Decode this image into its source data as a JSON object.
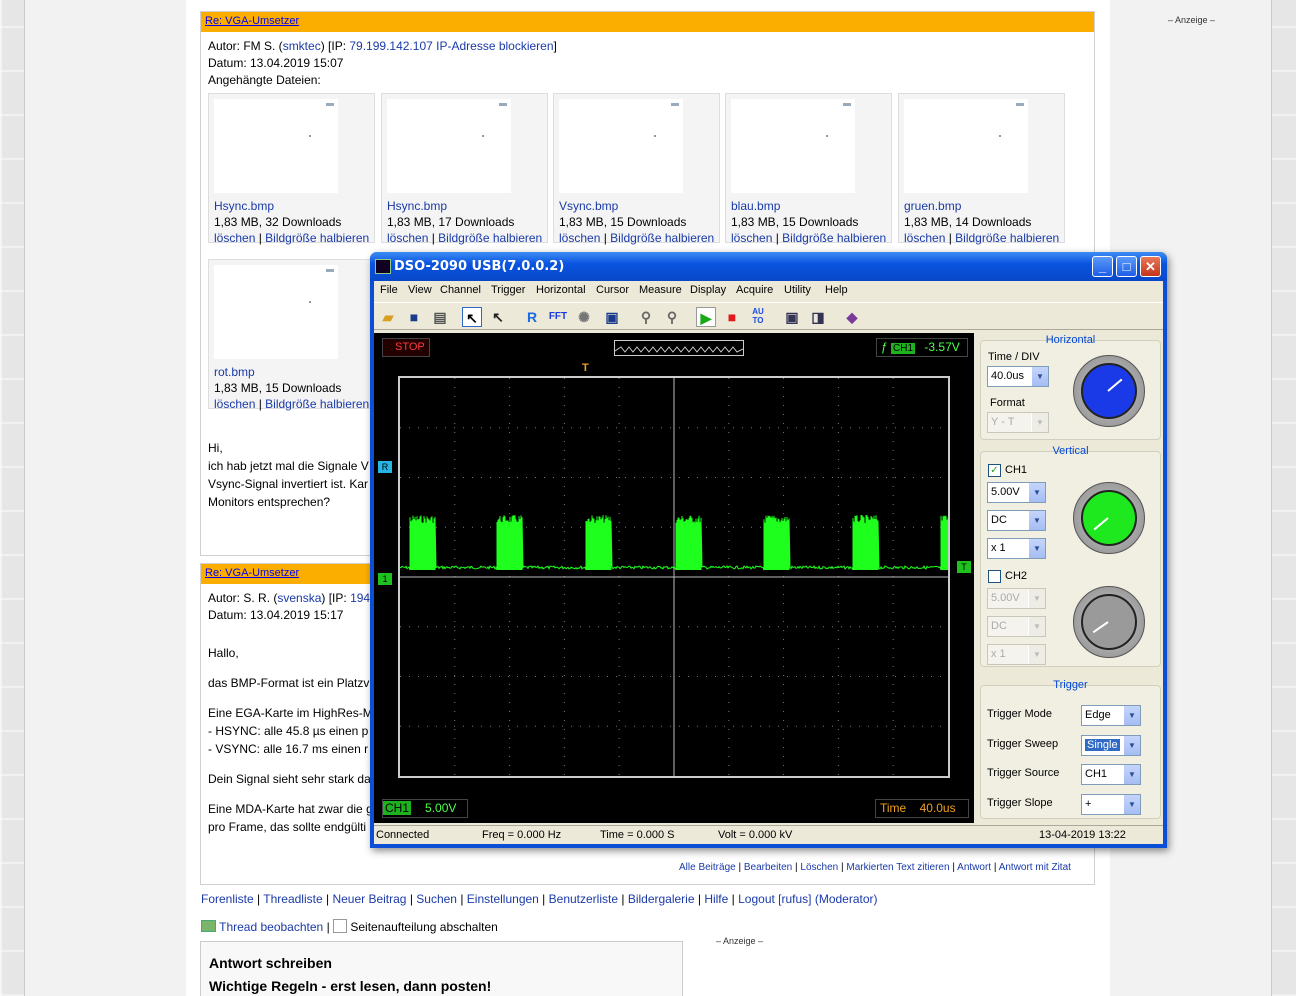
{
  "sidebar_ad": "– Anzeige –",
  "post1": {
    "title": "Re: VGA-Umsetzer",
    "author_label": "Autor: FM S. (",
    "author_user": "smktec",
    "author_ip_pre": ") [IP: ",
    "author_ip": "79.199.142.107",
    "ip_block": "IP-Adresse blockieren",
    "author_end": "]",
    "date": "Datum: 13.04.2019 15:07",
    "attachments_label": "Angehängte Dateien:",
    "attachments": [
      {
        "name": "Hsync.bmp",
        "size": "1,83 MB, 32 Downloads"
      },
      {
        "name": "Hsync.bmp",
        "size": "1,83 MB, 17 Downloads"
      },
      {
        "name": "Vsync.bmp",
        "size": "1,83 MB, 15 Downloads"
      },
      {
        "name": "blau.bmp",
        "size": "1,83 MB, 15 Downloads"
      },
      {
        "name": "gruen.bmp",
        "size": "1,83 MB, 14 Downloads"
      },
      {
        "name": "rot.bmp",
        "size": "1,83 MB, 15 Downloads"
      }
    ],
    "delete_label": "löschen",
    "sep": " | ",
    "halve_label": "Bildgröße halbieren",
    "body": [
      "Hi,",
      "ich hab jetzt mal die Signale V",
      "Vsync-Signal invertiert ist. Kar",
      "Monitors entsprechen?"
    ]
  },
  "post2": {
    "title": "Re: VGA-Umsetzer",
    "author_label": "Autor: S. R. (",
    "author_user": "svenska",
    "author_ip_pre": ") [IP: ",
    "author_ip": "194",
    "date": "Datum: 13.04.2019 15:17",
    "body": [
      "Hallo,",
      "das BMP-Format ist ein Platzv",
      "Eine EGA-Karte im HighRes-M",
      "- HSYNC: alle 45.8 µs einen p",
      "- VSYNC: alle 16.7 ms einen r",
      "Dein Signal sieht sehr stark da",
      "Eine MDA-Karte hat zwar die g",
      "pro Frame, das sollte endgülti"
    ]
  },
  "post_actions": [
    "Alle Beiträge",
    "Bearbeiten",
    "Löschen",
    "Markierten Text zitieren",
    "Antwort",
    "Antwort mit Zitat"
  ],
  "footer_nav": [
    "Forenliste",
    "Threadliste",
    "Neuer Beitrag",
    "Suchen",
    "Einstellungen",
    "Benutzerliste",
    "Bildergalerie",
    "Hilfe",
    "Logout [rufus] (Moderator)"
  ],
  "watch_thread": "Thread beobachten",
  "pagination_off": "Seitenaufteilung abschalten",
  "reply": {
    "title": "Antwort schreiben",
    "rules": "Wichtige Regeln - erst lesen, dann posten!"
  },
  "dso": {
    "title": "DSO-2090 USB(7.0.0.2)",
    "menu": [
      "File",
      "View",
      "Channel",
      "Trigger",
      "Horizontal",
      "Cursor",
      "Measure",
      "Display",
      "Acquire",
      "Utility",
      "Help"
    ],
    "stop": "STOP",
    "trigger_readout_ch": "CH1",
    "trigger_readout_val": "-3.57V",
    "ch1_readout_ch": "CH1",
    "ch1_readout_val": "5.00V",
    "time_readout_label": "Time",
    "time_readout_val": "40.0us",
    "horizontal": {
      "title": "Horizontal",
      "time_div_label": "Time / DIV",
      "time_div": "40.0us",
      "format_label": "Format",
      "format": "Y - T"
    },
    "vertical": {
      "title": "Vertical",
      "ch1_label": "CH1",
      "ch1_volt": "5.00V",
      "ch1_coupling": "DC",
      "ch1_probe": "x 1",
      "ch2_label": "CH2",
      "ch2_volt": "5.00V",
      "ch2_coupling": "DC",
      "ch2_probe": "x 1"
    },
    "trigger": {
      "title": "Trigger",
      "mode_label": "Trigger Mode",
      "mode": "Edge",
      "sweep_label": "Trigger Sweep",
      "sweep": "Single",
      "source_label": "Trigger Source",
      "source": "CH1",
      "slope_label": "Trigger Slope",
      "slope": "+"
    },
    "status": {
      "connected": "Connected",
      "freq": "Freq = 0.000 Hz",
      "time": "Time = 0.000 S",
      "volt": "Volt = 0.000 kV",
      "datetime": "13-04-2019  13:22"
    },
    "markers": {
      "ref": "R",
      "ch1": "1",
      "trig": "T"
    }
  }
}
